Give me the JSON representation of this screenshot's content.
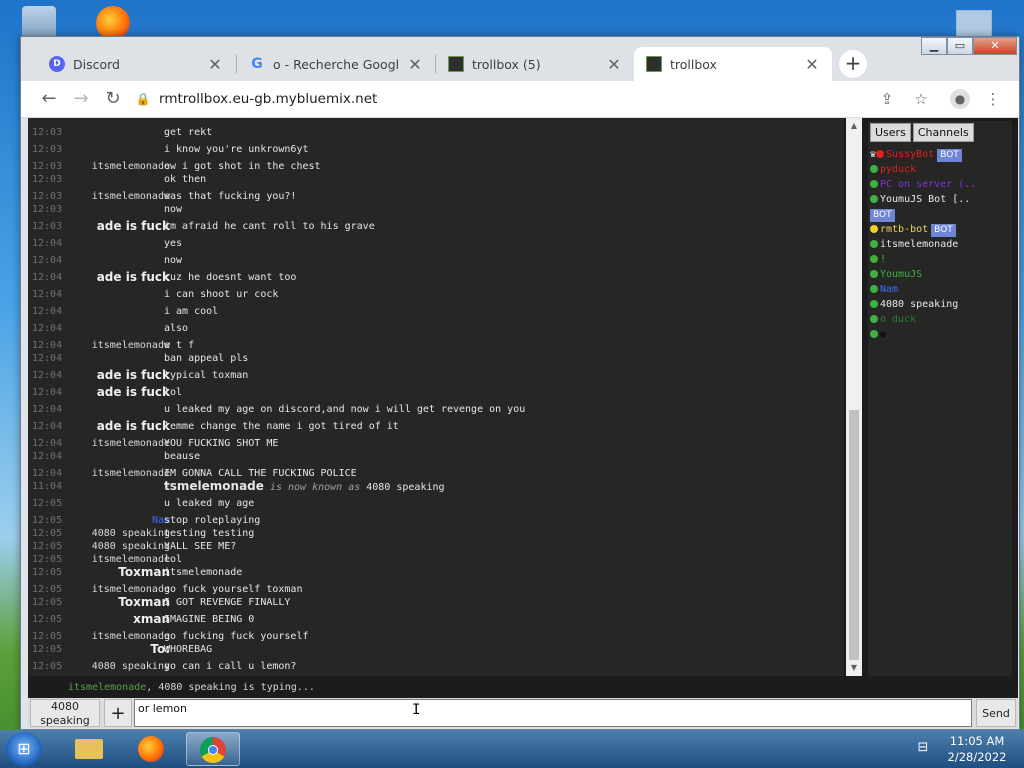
{
  "browser": {
    "tabs": [
      {
        "title": "Discord",
        "favicon": "discord-icon"
      },
      {
        "title": "o - Recherche Google",
        "favicon": "google-icon"
      },
      {
        "title": "trollbox (5)",
        "favicon": "trollbox-icon"
      },
      {
        "title": "trollbox",
        "favicon": "trollbox-icon",
        "active": true
      }
    ],
    "url": "rmtrollbox.eu-gb.mybluemix.net"
  },
  "chat": {
    "messages": [
      {
        "time": "12:03",
        "name": "",
        "text": "get rekt"
      },
      {
        "time": "12:03",
        "name": "",
        "text": "i know you're unkrown6yt"
      },
      {
        "time": "12:03",
        "name": "itsmelemonade",
        "text": "ow i got shot in the chest"
      },
      {
        "time": "12:03",
        "name": "",
        "text": "ok then"
      },
      {
        "time": "12:03",
        "name": "itsmelemonade",
        "text": "was that fucking you?!"
      },
      {
        "time": "12:03",
        "name": "",
        "text": "now"
      },
      {
        "time": "12:03",
        "name": "ade is fuck",
        "text": "im afraid he cant roll to his grave",
        "big": true
      },
      {
        "time": "12:04",
        "name": "",
        "text": "yes"
      },
      {
        "time": "12:04",
        "name": "",
        "text": "now"
      },
      {
        "time": "12:04",
        "name": "ade is fuck",
        "text": "cuz he doesnt want too",
        "big": true
      },
      {
        "time": "12:04",
        "name": "",
        "text": "i can shoot ur cock"
      },
      {
        "time": "12:04",
        "name": "",
        "text": "i am cool"
      },
      {
        "time": "12:04",
        "name": "",
        "text": "also"
      },
      {
        "time": "12:04",
        "name": "itsmelemonade",
        "text": "w          t                   f"
      },
      {
        "time": "12:04",
        "name": "",
        "text": "ban appeal pls"
      },
      {
        "time": "12:04",
        "name": "ade is fuck",
        "text": "typical toxman",
        "big": true
      },
      {
        "time": "12:04",
        "name": "ade is fuck",
        "text": "lol",
        "big": true
      },
      {
        "time": "12:04",
        "name": "",
        "text": "u leaked my age on discord,and now i will get revenge on you"
      },
      {
        "time": "12:04",
        "name": "ade is fuck",
        "text": "lemme change the name i got tired of it",
        "big": true
      },
      {
        "time": "12:04",
        "name": "itsmelemonade",
        "text": "YOU FUCKING SHOT ME"
      },
      {
        "time": "12:04",
        "name": "",
        "text": "beause"
      },
      {
        "time": "12:04",
        "name": "itsmelemonade",
        "text": "IM GONNA CALL THE FUCKING POLICE"
      },
      {
        "time": "11:04",
        "name": "-",
        "text": "",
        "rename_old": "tsmelemonade",
        "rename_mid": "is now known as",
        "rename_new": "4080 speaking"
      },
      {
        "time": "12:05",
        "name": "",
        "text": "u leaked my age"
      },
      {
        "time": "12:05",
        "name": "Nam",
        "text": "stop roleplaying",
        "blue": true
      },
      {
        "time": "12:05",
        "name": "4080 speaking",
        "text": "testing testing"
      },
      {
        "time": "12:05",
        "name": "4080 speaking",
        "text": "YALL SEE ME?"
      },
      {
        "time": "12:05",
        "name": "itsmelemonade",
        "text": "lol"
      },
      {
        "time": "12:05",
        "name": "Toxman",
        "text": "itsmelemonade",
        "big": true
      },
      {
        "time": "12:05",
        "name": "itsmelemonade",
        "text": "go fuck yourself toxman"
      },
      {
        "time": "12:05",
        "name": "Toxman",
        "text": "I GOT REVENGE FINALLY",
        "big": true
      },
      {
        "time": "12:05",
        "name": "xman",
        "text": "IMAGINE BEING 0",
        "big": true
      },
      {
        "time": "12:05",
        "name": "itsmelemonade",
        "text": "go fucking fuck yourself"
      },
      {
        "time": "12:05",
        "name": "To:",
        "text": "WHOREBAG",
        "big": true
      },
      {
        "time": "12:05",
        "name": "4080 speaking",
        "text": "yo can i call u lemon?"
      }
    ]
  },
  "users": {
    "tab_users": "Users",
    "tab_channels": "Channels",
    "bot_label": "BOT",
    "list": [
      {
        "name": "SussyBot",
        "color": "#e02020",
        "dot": "#e02020",
        "crown": "♛",
        "bot": true
      },
      {
        "name": "pyduck",
        "color": "#e02020",
        "dot": "#3fb13f"
      },
      {
        "name": "PC on server (..",
        "color": "#8a2be2",
        "dot": "#3fb13f"
      },
      {
        "name": "YoumuJS Bot [..",
        "color": "#e8e8e8",
        "dot": "#3fb13f",
        "bot_next_line": true
      },
      {
        "name": "rmtb-bot",
        "color": "#f0d060",
        "dot": "#f0d020",
        "bot": true
      },
      {
        "name": "itsmelemonade",
        "color": "#e8e8e8",
        "dot": "#3fb13f"
      },
      {
        "name": "!",
        "color": "#3fb13f",
        "dot": "#3fb13f"
      },
      {
        "name": "YoumuJS",
        "color": "#3fb13f",
        "dot": "#3fb13f"
      },
      {
        "name": "Nam",
        "color": "#3b6cff",
        "dot": "#3fb13f"
      },
      {
        "name": "4080 speaking",
        "color": "#e8e8e8",
        "dot": "#3fb13f"
      },
      {
        "name": "o duck",
        "color": "#2f7d2f",
        "dot": "#3fb13f"
      },
      {
        "name": "●",
        "color": "#111111",
        "dot": "#3fb13f"
      }
    ]
  },
  "typing": {
    "names": "itsmelemonade, 4080 speaking",
    "names_a": "itsmelemonade",
    "names_b": ", 4080 speaking",
    "suffix": " is typing..."
  },
  "input": {
    "nick": "4080 speaking",
    "plus": "+",
    "value": "or lemon",
    "send": "Send"
  },
  "taskbar": {
    "time": "11:05 AM",
    "date": "2/28/2022"
  },
  "colors": {
    "chat_bg": "#262725",
    "accent_blue": "#3b6cff"
  }
}
